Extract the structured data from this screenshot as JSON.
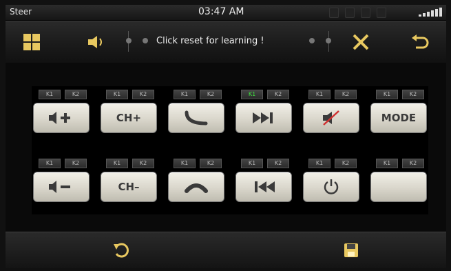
{
  "status": {
    "app": "Steer",
    "time": "03:47 AM"
  },
  "toolbar": {
    "message": "Click reset for learning !"
  },
  "keys": {
    "k1": "K1",
    "k2": "K2",
    "row1": [
      {
        "label": "",
        "k1_active": false
      },
      {
        "label": "CH+",
        "k1_active": false
      },
      {
        "label": "",
        "k1_active": false
      },
      {
        "label": "",
        "k1_active": true
      },
      {
        "label": "",
        "k1_active": false
      },
      {
        "label": "MODE",
        "k1_active": false
      }
    ],
    "row2": [
      {
        "label": ""
      },
      {
        "label": "CH–"
      },
      {
        "label": ""
      },
      {
        "label": ""
      },
      {
        "label": ""
      },
      {
        "label": ""
      }
    ]
  },
  "colors": {
    "accent_active": "#3fe03f",
    "key_face": "#d9d6cb"
  }
}
